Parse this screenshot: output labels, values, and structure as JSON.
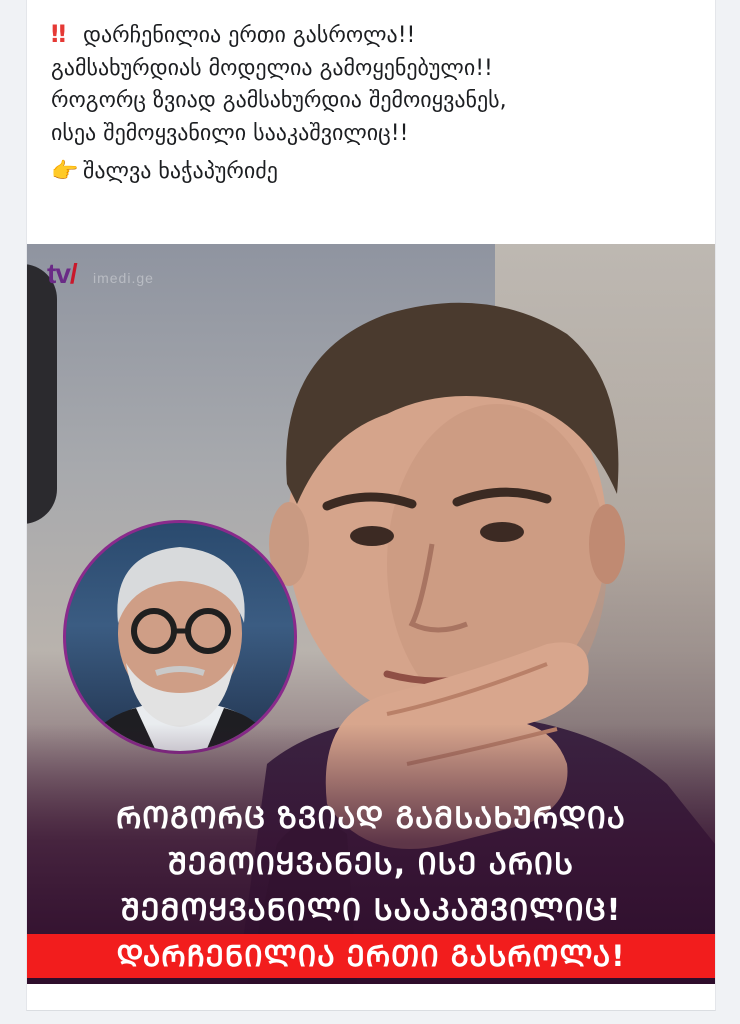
{
  "post": {
    "lines": [
      "დარჩენილია ერთი გასროლა!!",
      "გამსახურდიას მოდელია გამოყენებული!!",
      "როგორც ზვიად გამსახურდია შემოიყვანეს,",
      "ისეა შემოყვანილი სააკაშვილიც!!"
    ],
    "author": "შალვა ხაჭაპურიძე",
    "alert_emoji": "‼",
    "pointer_emoji": "👉"
  },
  "image": {
    "logo_text": "tv",
    "logo_sub": "imedi.ge",
    "headline_lines": [
      "ᲠᲝᲒᲝᲠᲪ ᲖᲕᲘᲐᲓ ᲒᲐᲛᲡᲐᲮᲣᲠᲓᲘᲐ",
      "ᲨᲔᲛᲝᲘᲧᲕᲐᲜᲔᲡ, ᲘᲡᲔ ᲐᲠᲘᲡ",
      "ᲨᲔᲛᲝᲧᲕᲐᲜᲘᲚᲘ ᲡᲐᲐᲙᲐᲨᲕᲘᲚᲘᲪ!"
    ],
    "banner_text": "ᲓᲐᲠᲩᲔᲜᲘᲚᲘᲐ ᲔᲠᲗᲘ ᲒᲐᲡᲠᲝᲚᲐ!",
    "colors": {
      "banner": "#f21d1d",
      "inset_border": "#8a2a8c",
      "logo": "#6a2a86"
    }
  }
}
